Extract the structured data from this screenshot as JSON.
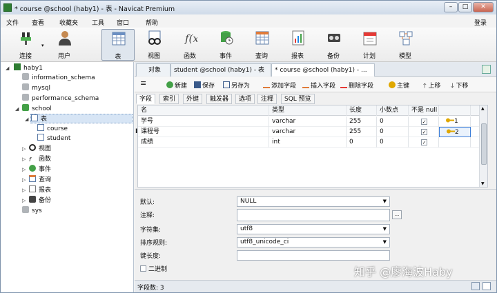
{
  "window": {
    "title": "* course @school (haby1) - 表 - Navicat Premium"
  },
  "menu": [
    "文件",
    "查看",
    "收藏夹",
    "工具",
    "窗口",
    "帮助"
  ],
  "login_label": "登录",
  "toolbar": [
    {
      "label": "连接",
      "icon": "connection-icon"
    },
    {
      "label": "用户",
      "icon": "user-icon"
    },
    {
      "label": "表",
      "icon": "table-icon"
    },
    {
      "label": "视图",
      "icon": "view-icon"
    },
    {
      "label": "函数",
      "icon": "function-icon"
    },
    {
      "label": "事件",
      "icon": "event-icon"
    },
    {
      "label": "查询",
      "icon": "query-icon"
    },
    {
      "label": "报表",
      "icon": "report-icon"
    },
    {
      "label": "备份",
      "icon": "backup-icon"
    },
    {
      "label": "计划",
      "icon": "schedule-icon"
    },
    {
      "label": "模型",
      "icon": "model-icon"
    }
  ],
  "tree": {
    "connection": "haby1",
    "dbs_before": [
      "information_schema",
      "mysql",
      "performance_schema"
    ],
    "school": "school",
    "table_group": "表",
    "tables": [
      "course",
      "student"
    ],
    "groups": [
      "视图",
      "函数",
      "事件",
      "查询",
      "报表",
      "备份"
    ],
    "dbs_after": [
      "sys"
    ]
  },
  "doc_tabs": [
    "对象",
    "student @school (haby1) - 表",
    "* course @school (haby1) - ..."
  ],
  "subtoolbar": [
    "新建",
    "保存",
    "另存为",
    "添加字段",
    "插入字段",
    "删除字段",
    "主键",
    "上移",
    "下移"
  ],
  "field_tabs": [
    "字段",
    "索引",
    "外键",
    "触发器",
    "选项",
    "注释",
    "SQL 预览"
  ],
  "grid": {
    "columns": [
      "名",
      "类型",
      "长度",
      "小数点",
      "不是 null",
      ""
    ],
    "rows": [
      {
        "name": "学号",
        "type": "varchar",
        "length": "255",
        "decimals": "0",
        "not_null": true,
        "key": "1"
      },
      {
        "name": "课程号",
        "type": "varchar",
        "length": "255",
        "decimals": "0",
        "not_null": true,
        "key": "2"
      },
      {
        "name": "成绩",
        "type": "int",
        "length": "0",
        "decimals": "0",
        "not_null": true,
        "key": ""
      }
    ]
  },
  "props": {
    "default_label": "默认:",
    "default_value": "NULL",
    "comment_label": "注释:",
    "comment_value": "",
    "charset_label": "字符集:",
    "charset_value": "utf8",
    "collation_label": "排序规则:",
    "collation_value": "utf8_unicode_ci",
    "keylen_label": "键长度:",
    "keylen_value": "",
    "binary_label": "二进制"
  },
  "status": {
    "field_count": "字段数: 3"
  },
  "watermark": "知乎 @廖海波Haby"
}
